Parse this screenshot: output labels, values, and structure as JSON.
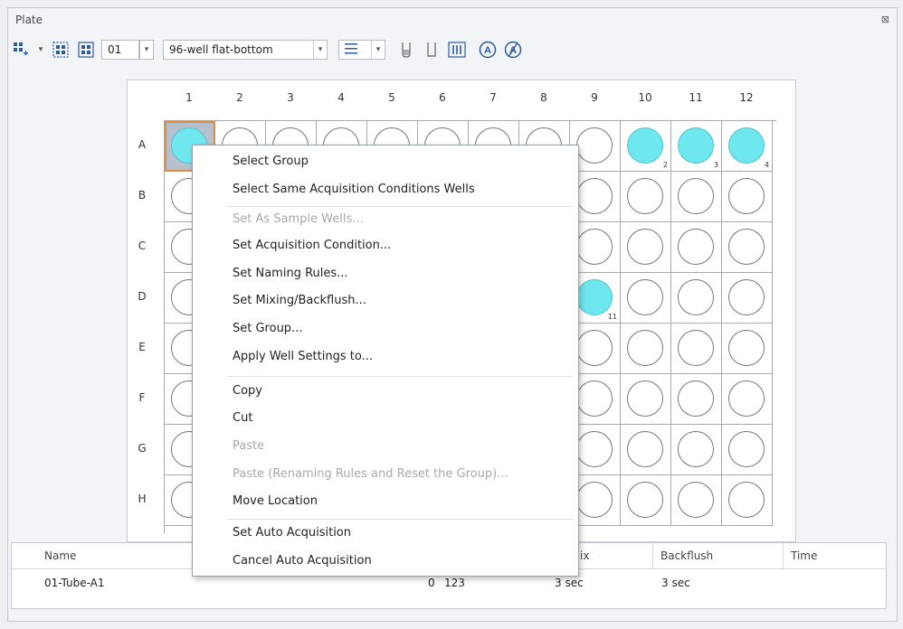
{
  "panel": {
    "title": "Plate",
    "close_glyph": "⊠"
  },
  "toolbar": {
    "plate_number": "01",
    "plate_type": "96-well flat-bottom",
    "icons": [
      "grid-add-icon",
      "dropdown-icon",
      "grid-expand-icon",
      "grid-select-icon",
      "list-icon",
      "tube-icon",
      "tube-empty-icon",
      "tube-rack-icon",
      "auto-acquisition-icon",
      "cancel-auto-acquisition-icon"
    ]
  },
  "plate": {
    "columns": [
      "1",
      "2",
      "3",
      "4",
      "5",
      "6",
      "7",
      "8",
      "9",
      "10",
      "11",
      "12"
    ],
    "rows": [
      "A",
      "B",
      "C",
      "D",
      "E",
      "F",
      "G",
      "H"
    ],
    "filled_wells": [
      {
        "well": "A1",
        "label": ""
      },
      {
        "well": "A10",
        "label": "2"
      },
      {
        "well": "A11",
        "label": "3"
      },
      {
        "well": "A12",
        "label": "4"
      },
      {
        "well": "D9",
        "label": "11"
      }
    ],
    "selected_well": "A1",
    "fill_color": "#6fe7ef"
  },
  "context_menu": {
    "items": [
      {
        "label": "Select Group",
        "enabled": true
      },
      {
        "label": "Select Same Acquisition Conditions Wells",
        "enabled": true
      },
      {
        "label": "Set As Sample Wells...",
        "enabled": false
      },
      {
        "label": "Set Acquisition Condition...",
        "enabled": true
      },
      {
        "label": "Set Naming Rules...",
        "enabled": true
      },
      {
        "label": "Set Mixing/Backflush...",
        "enabled": true
      },
      {
        "label": "Set Group...",
        "enabled": true
      },
      {
        "label": "Apply Well Settings to...",
        "enabled": true
      },
      {
        "label": "Copy",
        "enabled": true
      },
      {
        "label": "Cut",
        "enabled": true
      },
      {
        "label": "Paste",
        "enabled": false
      },
      {
        "label": "Paste (Renaming Rules and Reset the Group)...",
        "enabled": false
      },
      {
        "label": "Move Location",
        "enabled": true
      },
      {
        "label": "Set Auto Acquisition",
        "enabled": true
      },
      {
        "label": "Cancel Auto Acquisition",
        "enabled": true
      }
    ]
  },
  "table": {
    "headers": {
      "name": "Name",
      "mix": "ix",
      "backflush": "Backflush",
      "time": "Time"
    },
    "row": {
      "name": "01-Tube-A1",
      "value1": "0",
      "value2": "123",
      "mix": "3 sec",
      "backflush": "3 sec"
    }
  }
}
